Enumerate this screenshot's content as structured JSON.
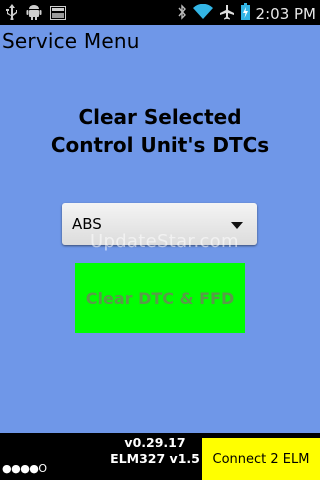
{
  "status_bar": {
    "time": "2:03 PM",
    "icons": [
      "usb-icon",
      "android-debug-icon",
      "image-icon",
      "bluetooth-icon",
      "wifi-icon",
      "airplane-icon",
      "battery-icon"
    ]
  },
  "app": {
    "title": "Service Menu",
    "heading": "Clear Selected Control Unit's DTCs",
    "background_color": "#6f97e8"
  },
  "selector": {
    "value": "ABS"
  },
  "watermark": "UpdateStar.com",
  "clear_button": {
    "label": "Clear DTC & FFD",
    "color": "#00ff00"
  },
  "footer": {
    "version_line1": "v0.29.17",
    "version_line2": "ELM327 v1.5",
    "connect_label": "Connect 2 ELM",
    "connect_color": "#ffff00",
    "indicator": "●●●●O"
  }
}
